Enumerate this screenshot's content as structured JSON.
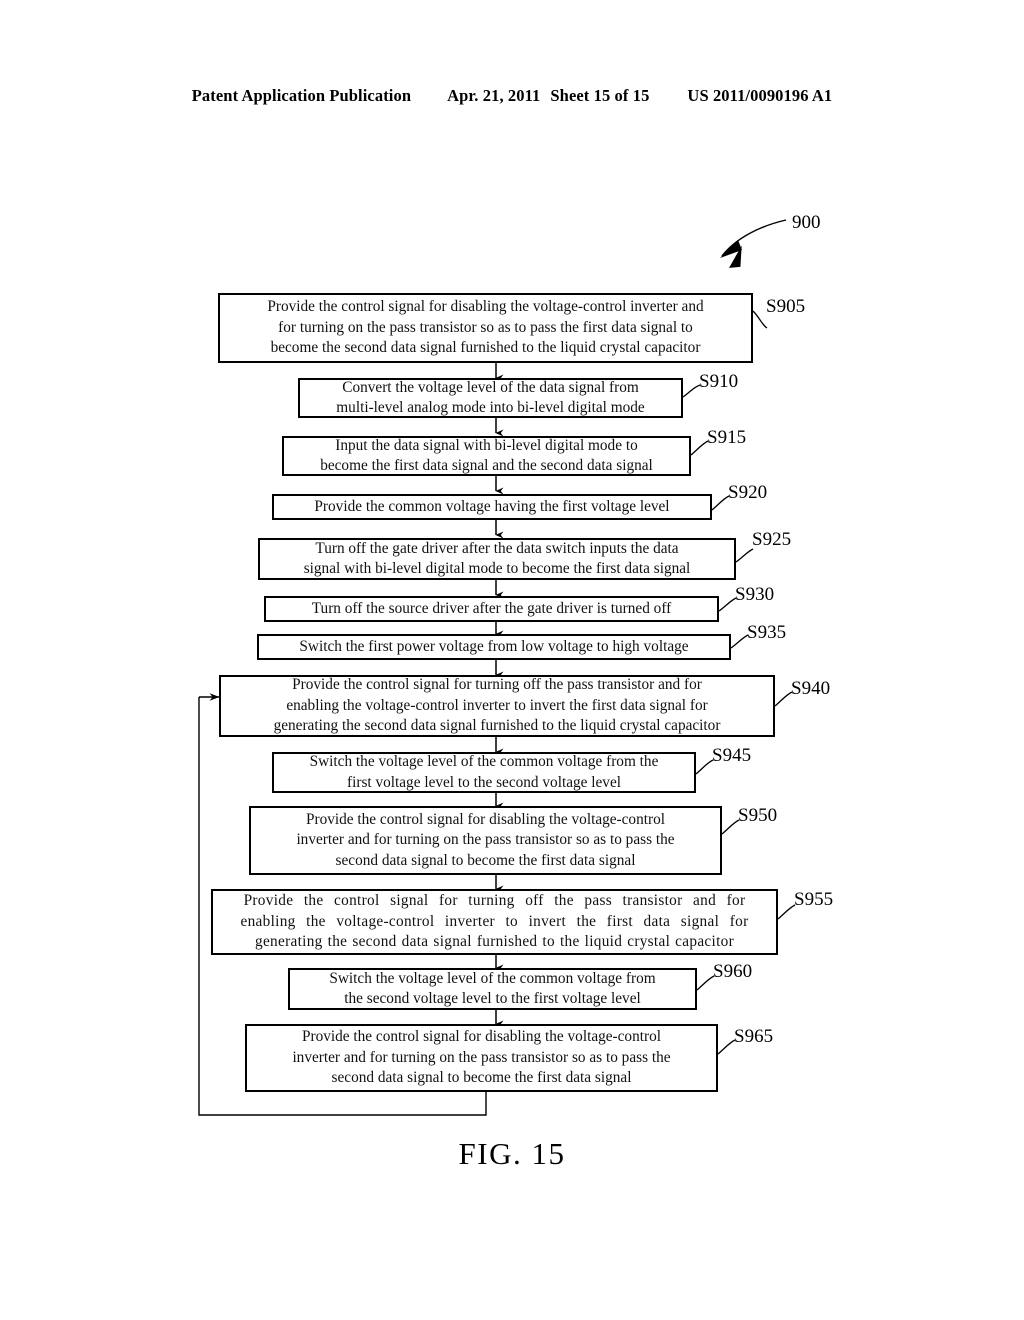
{
  "header": {
    "left": "Patent Application Publication",
    "date": "Apr. 21, 2011",
    "sheet": "Sheet 15 of 15",
    "patent_number": "US 2011/0090196 A1"
  },
  "figure": {
    "caption": "FIG. 15",
    "reference_numeral": "900"
  },
  "flowchart": {
    "steps": [
      {
        "id": "S905",
        "label": "S905",
        "lines": [
          "Provide the control signal for disabling the voltage-control inverter and",
          "for turning on the pass transistor so as to pass the first data signal to",
          "become the second data signal furnished to the liquid crystal capacitor"
        ]
      },
      {
        "id": "S910",
        "label": "S910",
        "lines": [
          "Convert the voltage level of the data signal from",
          "multi-level analog mode into bi-level digital mode"
        ]
      },
      {
        "id": "S915",
        "label": "S915",
        "lines": [
          "Input the data signal with bi-level digital mode to",
          "become the first data signal and the second data signal"
        ]
      },
      {
        "id": "S920",
        "label": "S920",
        "lines": [
          "Provide the common voltage having the first voltage level"
        ]
      },
      {
        "id": "S925",
        "label": "S925",
        "lines": [
          "Turn off the gate driver after the data switch inputs the data",
          "signal with bi-level digital mode to become the first data signal"
        ]
      },
      {
        "id": "S930",
        "label": "S930",
        "lines": [
          "Turn off the source driver after the gate driver is turned off"
        ]
      },
      {
        "id": "S935",
        "label": "S935",
        "lines": [
          "Switch the first power voltage from low voltage to high voltage"
        ]
      },
      {
        "id": "S940",
        "label": "S940",
        "lines": [
          "Provide the control signal for turning off the pass transistor and for",
          "enabling the voltage-control inverter to invert the first data signal for",
          "generating the second data signal furnished to the liquid crystal capacitor"
        ]
      },
      {
        "id": "S945",
        "label": "S945",
        "lines": [
          "Switch the voltage level of the common voltage from the",
          "first voltage level to the second voltage level"
        ]
      },
      {
        "id": "S950",
        "label": "S950",
        "lines": [
          "Provide the control signal for disabling the voltage-control",
          "inverter and for turning on the pass transistor so as to pass the",
          "second data signal to become the first data signal"
        ]
      },
      {
        "id": "S955",
        "label": "S955",
        "lines": [
          "Provide the control signal for turning off the pass transistor and for",
          "enabling the voltage-control inverter to invert the first data signal for",
          "generating the second data signal furnished to the liquid crystal capacitor"
        ]
      },
      {
        "id": "S960",
        "label": "S960",
        "lines": [
          "Switch the voltage level of the common voltage from",
          "the second voltage level to the first voltage level"
        ]
      },
      {
        "id": "S965",
        "label": "S965",
        "lines": [
          "Provide the control signal for disabling the voltage-control",
          "inverter and for turning on the pass transistor so as to pass the",
          "second data signal to become the first data signal"
        ]
      }
    ]
  }
}
